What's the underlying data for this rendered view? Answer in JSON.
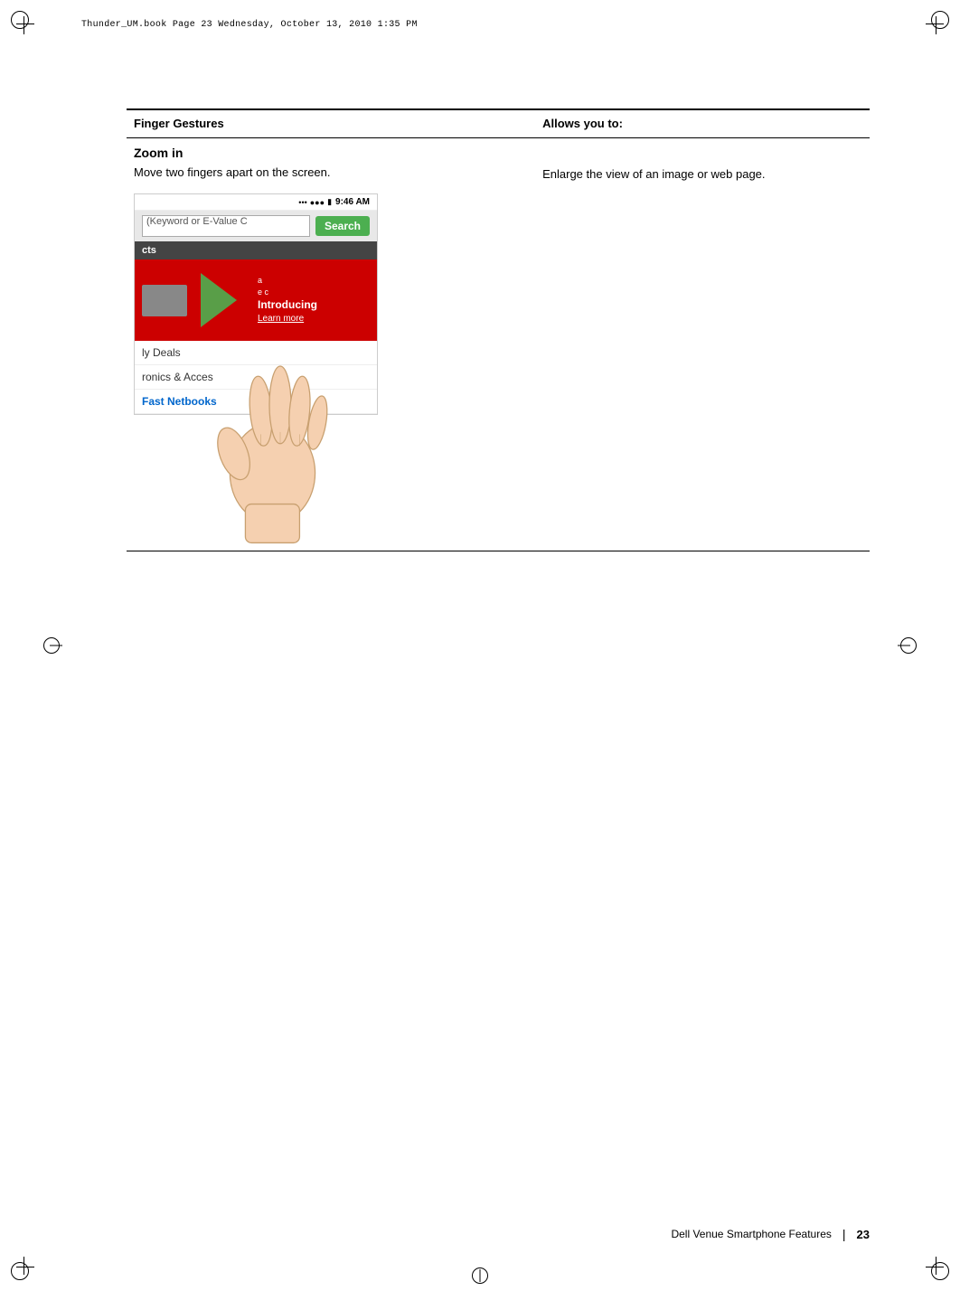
{
  "page": {
    "file_info": "Thunder_UM.book  Page 23  Wednesday, October 13, 2010  1:35 PM",
    "footer_left": "Dell Venue Smartphone Features",
    "footer_separator": "|",
    "footer_page": "23"
  },
  "table": {
    "col1_header": "Finger Gestures",
    "col2_header": "Allows you to:",
    "row1": {
      "title": "Zoom in",
      "description": "Move two fingers apart on the screen.",
      "allows": "Enlarge the view of an image or web page."
    }
  },
  "phone_ui": {
    "status_time": "9:46 AM",
    "search_placeholder": "(Keyword or E-Value C",
    "search_btn": "Search",
    "products_label": "cts",
    "deal_label": "ly Deals",
    "electronics_label": "ronics & Acces",
    "netbooks_label": "Fast Netbooks",
    "introducing": "Introducing",
    "learn_more": "Learn more"
  }
}
